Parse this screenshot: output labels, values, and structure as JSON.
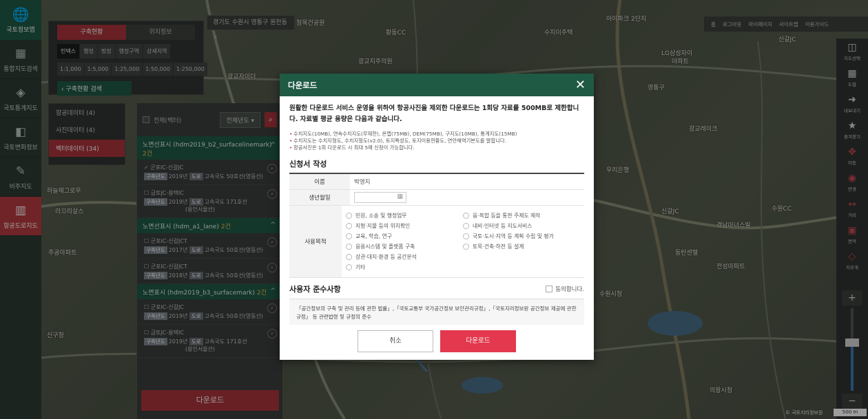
{
  "sidebar": {
    "logo_label": "국토정보맵",
    "items": [
      {
        "label": "통합지도검색",
        "icon": "search-map-icon"
      },
      {
        "label": "국토통계지도",
        "icon": "stats-map-icon"
      },
      {
        "label": "국토변화정보",
        "icon": "change-icon"
      },
      {
        "label": "비주지도",
        "icon": "visual-map-icon"
      },
      {
        "label": "항공도로지도",
        "icon": "book-map-icon"
      }
    ]
  },
  "search_panel": {
    "tabs": [
      "구축현황",
      "위치정보"
    ],
    "filters": [
      "인덱스",
      "행정",
      "법정",
      "행정구역",
      "상세지역"
    ],
    "scales": [
      "1:1,000",
      "1:5,000",
      "1:25,000",
      "1:50,000",
      "1:250,000"
    ],
    "back_label": "구축현황 검색",
    "address": "경기도 수원시 영통구 원천동"
  },
  "categories": [
    {
      "label": "항공데이터 (4)"
    },
    {
      "label": "사진데이터 (4)"
    },
    {
      "label": "벡터데이터 (34)"
    }
  ],
  "results": {
    "all_label": "전체(벡터)",
    "year_select": "전체년도",
    "groups": [
      {
        "title": "노면선표시 (hdm2019_b2_surfacelinemark)",
        "count": "2건",
        "items": [
          {
            "title": "군포IC-신갈JC",
            "tag1": "구축년도",
            "year": "2019년",
            "tag2": "도로",
            "road": "고속국도 50호선(영동선)"
          },
          {
            "title": "금토JC-용택IC",
            "tag1": "구축년도",
            "year": "2019년",
            "tag2": "도로",
            "road": "고속국도 171호선",
            "road2": "(용인서울선)"
          }
        ]
      },
      {
        "title": "노면선표시 (hdm_a1_lane)",
        "count": "2건",
        "items": [
          {
            "title": "군포IC-신갈JCT",
            "tag1": "구축년도",
            "year": "2017년",
            "tag2": "도로",
            "road": "고속국도 50호선(영동선)"
          },
          {
            "title": "군포IC-신갈JCT",
            "tag1": "구축년도",
            "year": "2018년",
            "tag2": "도로",
            "road": "고속국도 50호선(영동선)"
          }
        ]
      },
      {
        "title": "노면표시 (hdm2019_b3_surfacemark)",
        "count": "2건",
        "items": [
          {
            "title": "군포IC-신갈JC",
            "tag1": "구축년도",
            "year": "2019년",
            "tag2": "도로",
            "road": "고속국도 50호선(영동선)"
          },
          {
            "title": "금토JC-용택IC",
            "tag1": "구축년도",
            "year": "2019년",
            "tag2": "도로",
            "road": "고속국도 171호선",
            "road2": "(용인서울선)"
          }
        ]
      }
    ],
    "download_label": "다운로드"
  },
  "top_right": {
    "items": [
      "홈",
      "로그아웃",
      "마이페이지",
      "사이트맵",
      "이용가이드"
    ]
  },
  "right_tools": [
    {
      "label": "지도선택",
      "icon": "map-select-icon"
    },
    {
      "label": "도엽",
      "icon": "grid-icon"
    },
    {
      "label": "내보내기",
      "icon": "export-icon"
    },
    {
      "label": "즐겨찾기",
      "icon": "star-icon"
    },
    {
      "label": "이동",
      "icon": "move-icon"
    },
    {
      "label": "반경",
      "icon": "radius-icon"
    },
    {
      "label": "거리",
      "icon": "distance-icon"
    },
    {
      "label": "면적",
      "icon": "area-icon"
    },
    {
      "label": "지우개",
      "icon": "eraser-icon"
    }
  ],
  "zoom": {
    "in": "+",
    "out": "−",
    "level": 0.58
  },
  "scale_text": "500 m",
  "copyright": "© 국토지리정보원",
  "map_labels": [
    "청목건공원",
    "황동CC",
    "수지이주택",
    "LG삼성자이",
    "아파트",
    "광교지주의원",
    "아이파크 2단지",
    "신갈JC",
    "광교자이더",
    "광교레이크",
    "영통구",
    "우리은행",
    "하늘채그로우",
    "라끄리살스",
    "주공아파트",
    "수원CC",
    "신갈JC",
    "경남아너스빌",
    "동탄센텔",
    "전성아파트",
    "수원시청",
    "신구청",
    "의왕시청"
  ],
  "modal": {
    "title": "다운로드",
    "lead": "원활한 다운로드 서비스 운영을 위하여 항공사진을 제외한 다운로드는 1회당 자료를 500MB로 제한합니다. 자료별 평균 용량은 다음과 같습니다.",
    "notes": [
      "수치지도(10MB), 연속수치지도(무제한), 온맵(75MB), DEM(75MB), 구지도(10MB), 통계지도(15MB)",
      "수치지도는 수치지형도, 수치지형도(v2.0), 토지특성도, 토지이용현황도, 연안해역기본도를 말합니다.",
      "항공사진은 1회 다운로드 시 최대 5매 신청이 가능합니다."
    ],
    "form_title": "신청서 작성",
    "name_label": "이름",
    "name_value": "박영지",
    "birth_label": "생년월일",
    "purpose_label": "사용목적",
    "purposes": [
      "민원, 소송 및 행정업무",
      "융·복합 등을 통한 주제도 제작",
      "지형·지물 등의 위치확인",
      "내비·인터넷 등 지도서비스",
      "교육, 학습, 연구",
      "국토·도시·지역 등 계획 수립 및 평가",
      "응용시스템 및 플랫폼 구축",
      "토목·건축·하천 등 설계",
      "상권·대지·환경 등 공간분석",
      "기타"
    ],
    "compliance_title": "사용자 준수사항",
    "agree_label": "동의합니다.",
    "compliance_text": "「공간정보의 구축 및 관리 등에 관한 법률」,「국토교통부 국가공간정보 보안관리규정」,「국토지리정보원 공간정보 제공에 관한 규정」 등 관련법령 및 규정의 준수",
    "cancel_label": "취소",
    "download_label": "다운로드"
  }
}
